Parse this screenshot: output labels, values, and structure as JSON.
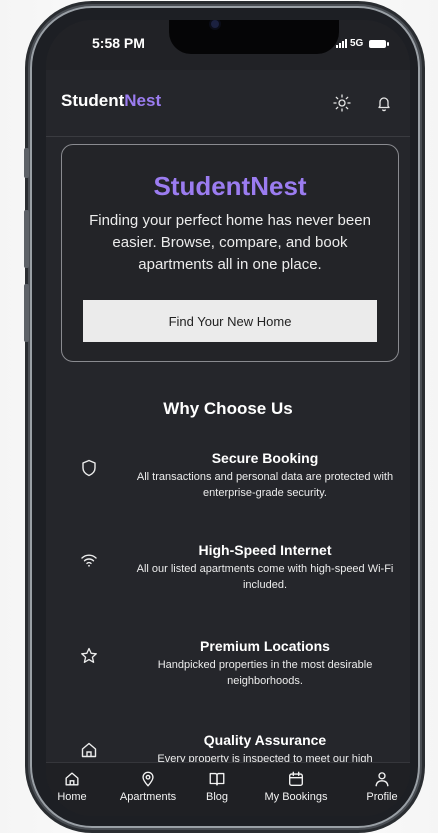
{
  "status": {
    "time": "5:58 PM",
    "network": "5G"
  },
  "header": {
    "brand_part1": "Student",
    "brand_part2": "Nest"
  },
  "hero": {
    "title": "StudentNest",
    "description": "Finding your perfect home has never been easier. Browse, compare, and book apartments all in one place.",
    "cta_label": "Find Your New Home"
  },
  "why": {
    "title": "Why Choose Us",
    "features": [
      {
        "icon": "shield-icon",
        "title": "Secure Booking",
        "description": "All transactions and personal data are protected with enterprise-grade security."
      },
      {
        "icon": "wifi-icon",
        "title": "High-Speed Internet",
        "description": "All our listed apartments come with high-speed Wi-Fi included."
      },
      {
        "icon": "star-icon",
        "title": "Premium Locations",
        "description": "Handpicked properties in the most desirable neighborhoods."
      },
      {
        "icon": "home-icon",
        "title": "Quality Assurance",
        "description": "Every property is inspected to meet our high"
      }
    ]
  },
  "tabs": [
    {
      "icon": "home-icon",
      "label": "Home"
    },
    {
      "icon": "map-pin-icon",
      "label": "Apartments"
    },
    {
      "icon": "book-icon",
      "label": "Blog"
    },
    {
      "icon": "calendar-icon",
      "label": "My Bookings"
    },
    {
      "icon": "user-icon",
      "label": "Profile"
    }
  ],
  "colors": {
    "accent": "#9b7cf0",
    "background": "#25262b",
    "text": "#ffffff"
  }
}
